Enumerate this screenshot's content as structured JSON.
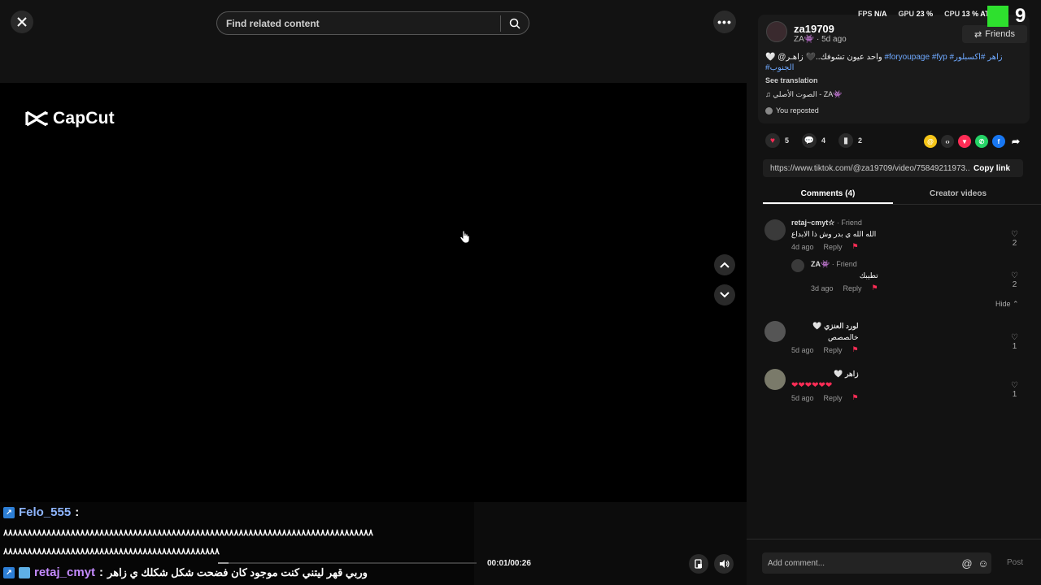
{
  "header": {
    "search_placeholder": "Find related content"
  },
  "video": {
    "watermark": "CapCut",
    "time": "00:01/00:26",
    "progress_fraction": 0.04
  },
  "chat_overlay": {
    "user1": "Felo_555",
    "user1_message_line1": "٨٨٨٨٨٨٨٨٨٨٨٨٨٨٨٨٨٨٨٨٨٨٨٨٨٨٨٨٨٨٨٨٨٨٨٨٨٨٨٨٨٨٨٨٨٨٨٨٨٨٨٨٨٨٨٨٨٨٨٨٨٨٨٨٨٨٨٨٨٨٨٨٨٨٨٨٨",
    "user1_message_line2": "٨٨٨٨٨٨٨٨٨٨٨٨٨٨٨٨٨٨٨٨٨٨٨٨٨٨٨٨٨٨٨٨٨٨٨٨٨٨٨٨٨٨٨٨٨",
    "user2": "retaj_cmyt",
    "user2_message": "وربي قهر ليتني كنت موجود كان فضحت شكل شكلك ي زاهر"
  },
  "hud": {
    "fps_label": "FPS",
    "fps_value": "N/A",
    "gpu_label": "GPU",
    "gpu_value": "23 %",
    "cpu_label": "CPU",
    "cpu_value": "13 %",
    "extra": "AT",
    "logo_number": "9"
  },
  "author": {
    "username": "za19709",
    "display": "ZA👾 · 5d ago",
    "follow_label": "Friends",
    "description_arabic": "واحد عيون تشوفك..🖤 زاهـر@ 🤍",
    "description_tags": "#foryoupage #fyp #زاهر #اكسبلور",
    "description_tag2": "#الجنوب",
    "see_translation": "See translation",
    "music": "♫  الصوت الأصلي - ZA👾",
    "reposted": "You reposted"
  },
  "stats": {
    "likes": "5",
    "comments": "4",
    "saves": "2"
  },
  "share": {
    "link": "https://www.tiktok.com/@za19709/video/75849211973...",
    "copy_label": "Copy link"
  },
  "tabs": [
    {
      "label": "Comments (4)",
      "active": true
    },
    {
      "label": "Creator videos",
      "active": false
    }
  ],
  "comments": [
    {
      "name": "retaj~cmyt☆",
      "tag": " · Friend",
      "text": "الله الله ي بدر وش ذا الابداع",
      "time": "4d ago",
      "reply": "Reply",
      "likes": "2"
    },
    {
      "name": "ZA👾",
      "tag": " · Friend",
      "text": "تطيبك",
      "time": "3d ago",
      "reply": "Reply",
      "likes": "2"
    },
    {
      "name": "لورد العنزي 🤍",
      "tag": "",
      "text": "خالصصص",
      "time": "5d ago",
      "reply": "Reply",
      "likes": "1"
    },
    {
      "name": "زاهر 🤍",
      "tag": "",
      "text": "❤❤❤❤❤❤",
      "time": "5d ago",
      "reply": "Reply",
      "likes": "1"
    }
  ],
  "hide_label": "Hide ⌃",
  "composer": {
    "placeholder": "Add comment...",
    "post_label": "Post"
  }
}
